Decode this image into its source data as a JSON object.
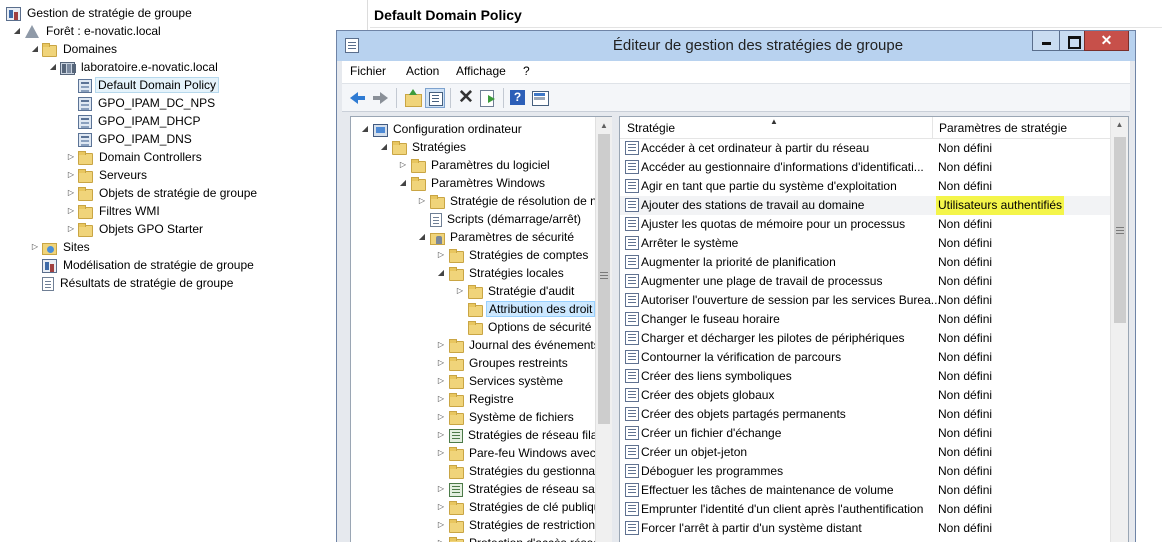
{
  "background": {
    "right_title": "Default Domain Policy",
    "tree": [
      {
        "label": "Gestion de stratégie de groupe",
        "icon": "gpmc-icon",
        "expander": ""
      },
      {
        "label": "Forêt : e-novatic.local",
        "icon": "forest-icon",
        "expander": "◢"
      },
      {
        "label": "Domaines",
        "icon": "folder-icon",
        "expander": "◢"
      },
      {
        "label": "laboratoire.e-novatic.local",
        "icon": "domain-icon",
        "expander": "◢"
      },
      {
        "label": "Default Domain Policy",
        "icon": "gpo-link-icon",
        "expander": "",
        "selected": true
      },
      {
        "label": "GPO_IPAM_DC_NPS",
        "icon": "gpo-link-icon",
        "expander": ""
      },
      {
        "label": "GPO_IPAM_DHCP",
        "icon": "gpo-link-icon",
        "expander": ""
      },
      {
        "label": "GPO_IPAM_DNS",
        "icon": "gpo-link-icon",
        "expander": ""
      },
      {
        "label": "Domain Controllers",
        "icon": "folder-icon",
        "expander": "▷"
      },
      {
        "label": "Serveurs",
        "icon": "folder-icon",
        "expander": "▷"
      },
      {
        "label": "Objets de stratégie de groupe",
        "icon": "folder-icon",
        "expander": "▷"
      },
      {
        "label": "Filtres WMI",
        "icon": "folder-icon",
        "expander": "▷"
      },
      {
        "label": "Objets GPO Starter",
        "icon": "folder-icon",
        "expander": "▷"
      },
      {
        "label": "Sites",
        "icon": "sites-icon",
        "expander": "▷"
      },
      {
        "label": "Modélisation de stratégie de groupe",
        "icon": "modeling-icon",
        "expander": ""
      },
      {
        "label": "Résultats de stratégie de groupe",
        "icon": "results-icon",
        "expander": ""
      }
    ]
  },
  "editor": {
    "title": "Éditeur de gestion des stratégies de groupe",
    "menus": [
      "Fichier",
      "Action",
      "Affichage",
      "?"
    ],
    "close_label": "✕",
    "tree": [
      {
        "label": "Configuration ordinateur",
        "icon": "computer-icon",
        "expander": "◢"
      },
      {
        "label": "Stratégies",
        "icon": "folder-icon",
        "expander": "◢"
      },
      {
        "label": "Paramètres du logiciel",
        "icon": "folder-icon",
        "expander": "▷"
      },
      {
        "label": "Paramètres Windows",
        "icon": "folder-icon",
        "expander": "◢"
      },
      {
        "label": "Stratégie de résolution de n",
        "icon": "folder-icon",
        "expander": "▷"
      },
      {
        "label": "Scripts (démarrage/arrêt)",
        "icon": "document-icon",
        "expander": ""
      },
      {
        "label": "Paramètres de sécurité",
        "icon": "security-icon",
        "expander": "◢"
      },
      {
        "label": "Stratégies de comptes",
        "icon": "folder-icon",
        "expander": "▷"
      },
      {
        "label": "Stratégies locales",
        "icon": "folder-icon",
        "expander": "◢"
      },
      {
        "label": "Stratégie d'audit",
        "icon": "folder-icon",
        "expander": "▷"
      },
      {
        "label": "Attribution des droit",
        "icon": "folder-icon",
        "expander": "",
        "selected": true
      },
      {
        "label": "Options de sécurité",
        "icon": "folder-icon",
        "expander": ""
      },
      {
        "label": "Journal des événements",
        "icon": "folder-icon",
        "expander": "▷"
      },
      {
        "label": "Groupes restreints",
        "icon": "folder-icon",
        "expander": "▷"
      },
      {
        "label": "Services système",
        "icon": "folder-icon",
        "expander": "▷"
      },
      {
        "label": "Registre",
        "icon": "folder-icon",
        "expander": "▷"
      },
      {
        "label": "Système de fichiers",
        "icon": "folder-icon",
        "expander": "▷"
      },
      {
        "label": "Stratégies de réseau filai",
        "icon": "network-icon",
        "expander": "▷"
      },
      {
        "label": "Pare-feu Windows avec",
        "icon": "folder-icon",
        "expander": "▷"
      },
      {
        "label": "Stratégies du gestionnai",
        "icon": "folder-icon",
        "expander": ""
      },
      {
        "label": "Stratégies de réseau san",
        "icon": "network-icon",
        "expander": "▷"
      },
      {
        "label": "Stratégies de clé publiqu",
        "icon": "folder-icon",
        "expander": "▷"
      },
      {
        "label": "Stratégies de restriction",
        "icon": "folder-icon",
        "expander": "▷"
      },
      {
        "label": "Protection d'accès résea",
        "icon": "folder-icon",
        "expander": "▷"
      }
    ],
    "list": {
      "col_policy": "Stratégie",
      "col_setting": "Paramètres de stratégie",
      "rows": [
        {
          "name": "Accéder à cet ordinateur à partir du réseau",
          "value": "Non défini"
        },
        {
          "name": "Accéder au gestionnaire d'informations d'identificati...",
          "value": "Non défini"
        },
        {
          "name": "Agir en tant que partie du système d'exploitation",
          "value": "Non défini"
        },
        {
          "name": "Ajouter des stations de travail au domaine",
          "value": "Utilisateurs authentifiés",
          "highlight": true
        },
        {
          "name": "Ajuster les quotas de mémoire pour un processus",
          "value": "Non défini"
        },
        {
          "name": "Arrêter le système",
          "value": "Non défini"
        },
        {
          "name": "Augmenter la priorité de planification",
          "value": "Non défini"
        },
        {
          "name": "Augmenter une plage de travail de processus",
          "value": "Non défini"
        },
        {
          "name": "Autoriser l'ouverture de session par les services Burea...",
          "value": "Non défini"
        },
        {
          "name": "Changer le fuseau horaire",
          "value": "Non défini"
        },
        {
          "name": "Charger et décharger les pilotes de périphériques",
          "value": "Non défini"
        },
        {
          "name": "Contourner la vérification de parcours",
          "value": "Non défini"
        },
        {
          "name": "Créer des liens symboliques",
          "value": "Non défini"
        },
        {
          "name": "Créer des objets globaux",
          "value": "Non défini"
        },
        {
          "name": "Créer des objets partagés permanents",
          "value": "Non défini"
        },
        {
          "name": "Créer un fichier d'échange",
          "value": "Non défini"
        },
        {
          "name": "Créer un objet-jeton",
          "value": "Non défini"
        },
        {
          "name": "Déboguer les programmes",
          "value": "Non défini"
        },
        {
          "name": "Effectuer les tâches de maintenance de volume",
          "value": "Non défini"
        },
        {
          "name": "Emprunter l'identité d'un client après l'authentification",
          "value": "Non défini"
        },
        {
          "name": "Forcer l'arrêt à partir d'un système distant",
          "value": "Non défini"
        }
      ]
    }
  },
  "colors": {
    "highlight": "#f4f54a",
    "titlebar": "#b8d2ef",
    "close": "#c7504a",
    "selection": "#cce8ff"
  }
}
